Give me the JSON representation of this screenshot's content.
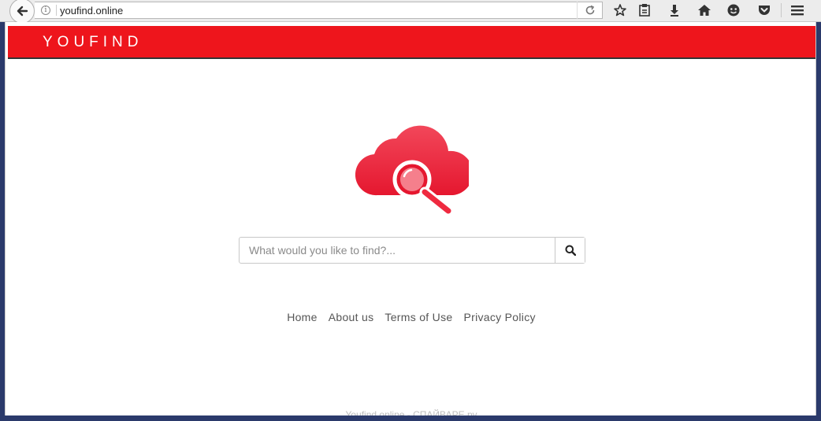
{
  "browser": {
    "url": "youfind.online",
    "info_glyph": "i",
    "icons": [
      "back-arrow-icon",
      "info-icon",
      "reload-icon",
      "bookmark-star-icon",
      "reading-list-icon",
      "download-icon",
      "home-icon",
      "hello-icon",
      "pocket-icon",
      "menu-icon"
    ]
  },
  "header": {
    "brand": "YOUFIND",
    "color": "#ee151c"
  },
  "search": {
    "placeholder": "What would you like to find?..."
  },
  "footer": {
    "links": [
      "Home",
      "About us",
      "Terms of Use",
      "Privacy Policy"
    ]
  },
  "watermark": "Youfind.online - СПАЙВАРЕ.ру"
}
